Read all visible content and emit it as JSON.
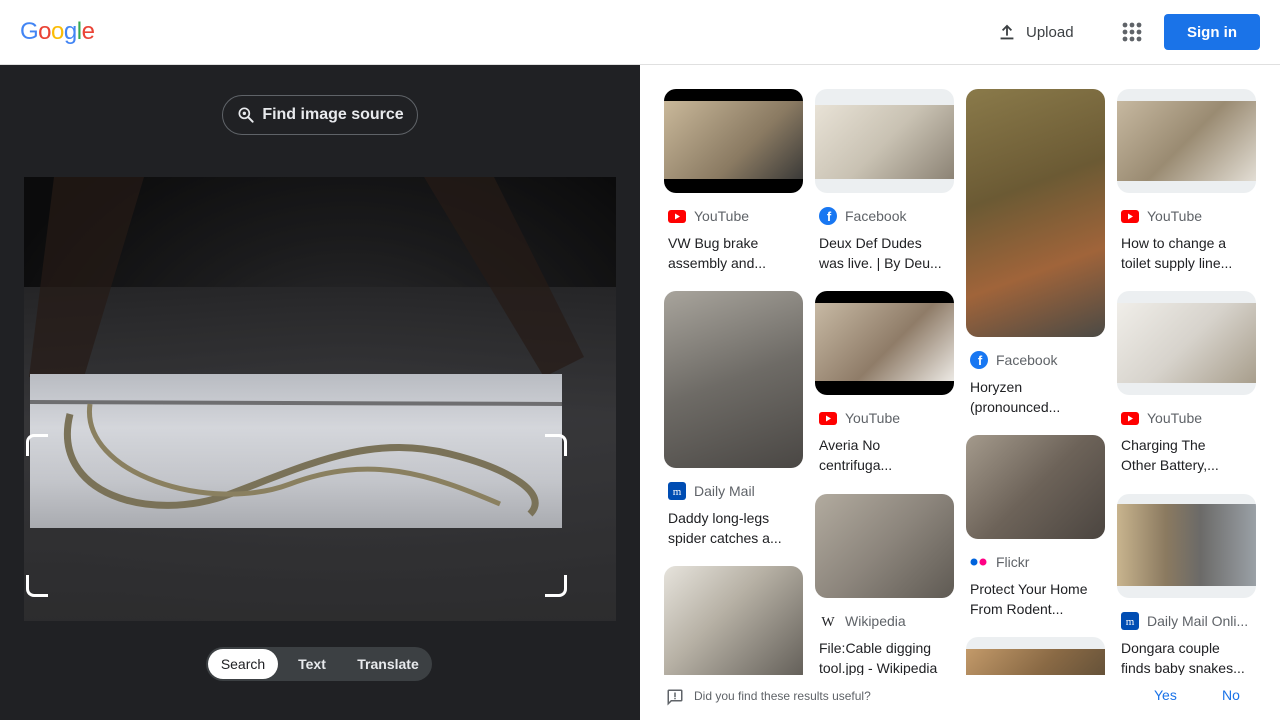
{
  "header": {
    "logo_letters": [
      "G",
      "o",
      "o",
      "g",
      "l",
      "e"
    ],
    "logo_colors": [
      "#4285f4",
      "#ea4335",
      "#fbbc05",
      "#4285f4",
      "#34a853",
      "#ea4335"
    ],
    "upload_label": "Upload",
    "signin_label": "Sign in"
  },
  "left": {
    "find_source_label": "Find image source",
    "modes": [
      {
        "label": "Search",
        "active": true
      },
      {
        "label": "Text",
        "active": false
      },
      {
        "label": "Translate",
        "active": false
      }
    ]
  },
  "results": [
    {
      "source": "YouTube",
      "icon": "youtube-icon",
      "title_lines": [
        "VW Bug brake",
        "assembly and..."
      ],
      "thumb_color": "#8a7a62"
    },
    {
      "source": "Facebook",
      "icon": "facebook-icon",
      "title_lines": [
        "Deux Def Dudes",
        "was live. | By Deu..."
      ],
      "thumb_color": "#c9c2b3"
    },
    {
      "source": "Facebook",
      "icon": "facebook-icon",
      "title_lines": [
        "Horyzen",
        "(pronounced..."
      ],
      "thumb_color": "#6b5a34"
    },
    {
      "source": "YouTube",
      "icon": "youtube-icon",
      "title_lines": [
        "How to change a",
        "toilet supply line..."
      ],
      "thumb_color": "#9a8b72"
    },
    {
      "source": "Daily Mail",
      "icon": "dailymail-icon",
      "title_lines": [
        "Daddy long-legs",
        "spider catches a..."
      ],
      "thumb_color": "#6e6b66"
    },
    {
      "source": "YouTube",
      "icon": "youtube-icon",
      "title_lines": [
        "Averia No",
        "centrifuga..."
      ],
      "thumb_color": "#8f7c68"
    },
    {
      "source": "Flickr",
      "icon": "flickr-icon",
      "title_lines": [
        "Protect Your Home",
        "From Rodent..."
      ],
      "thumb_color": "#6d6359"
    },
    {
      "source": "YouTube",
      "icon": "youtube-icon",
      "title_lines": [
        "Charging The",
        "Other Battery,..."
      ],
      "thumb_color": "#d7d3cc"
    },
    {
      "source": "Wikipedia",
      "icon": "wikipedia-icon",
      "title_lines": [
        "File:Cable digging",
        "tool.jpg - Wikipedia"
      ],
      "thumb_color": "#8c857c"
    },
    {
      "source": "Daily Mail Onli...",
      "icon": "dailymail-icon",
      "title_lines": [
        "Dongara couple",
        "finds baby snakes..."
      ],
      "thumb_color": "#8b7a60"
    },
    {
      "source": "",
      "icon": "",
      "title_lines": [],
      "thumb_color": "#b7b1a5"
    },
    {
      "source": "",
      "icon": "",
      "title_lines": [],
      "thumb_color": "#8a6a45"
    }
  ],
  "feedback": {
    "question": "Did you find these results useful?",
    "yes_label": "Yes",
    "no_label": "No"
  }
}
